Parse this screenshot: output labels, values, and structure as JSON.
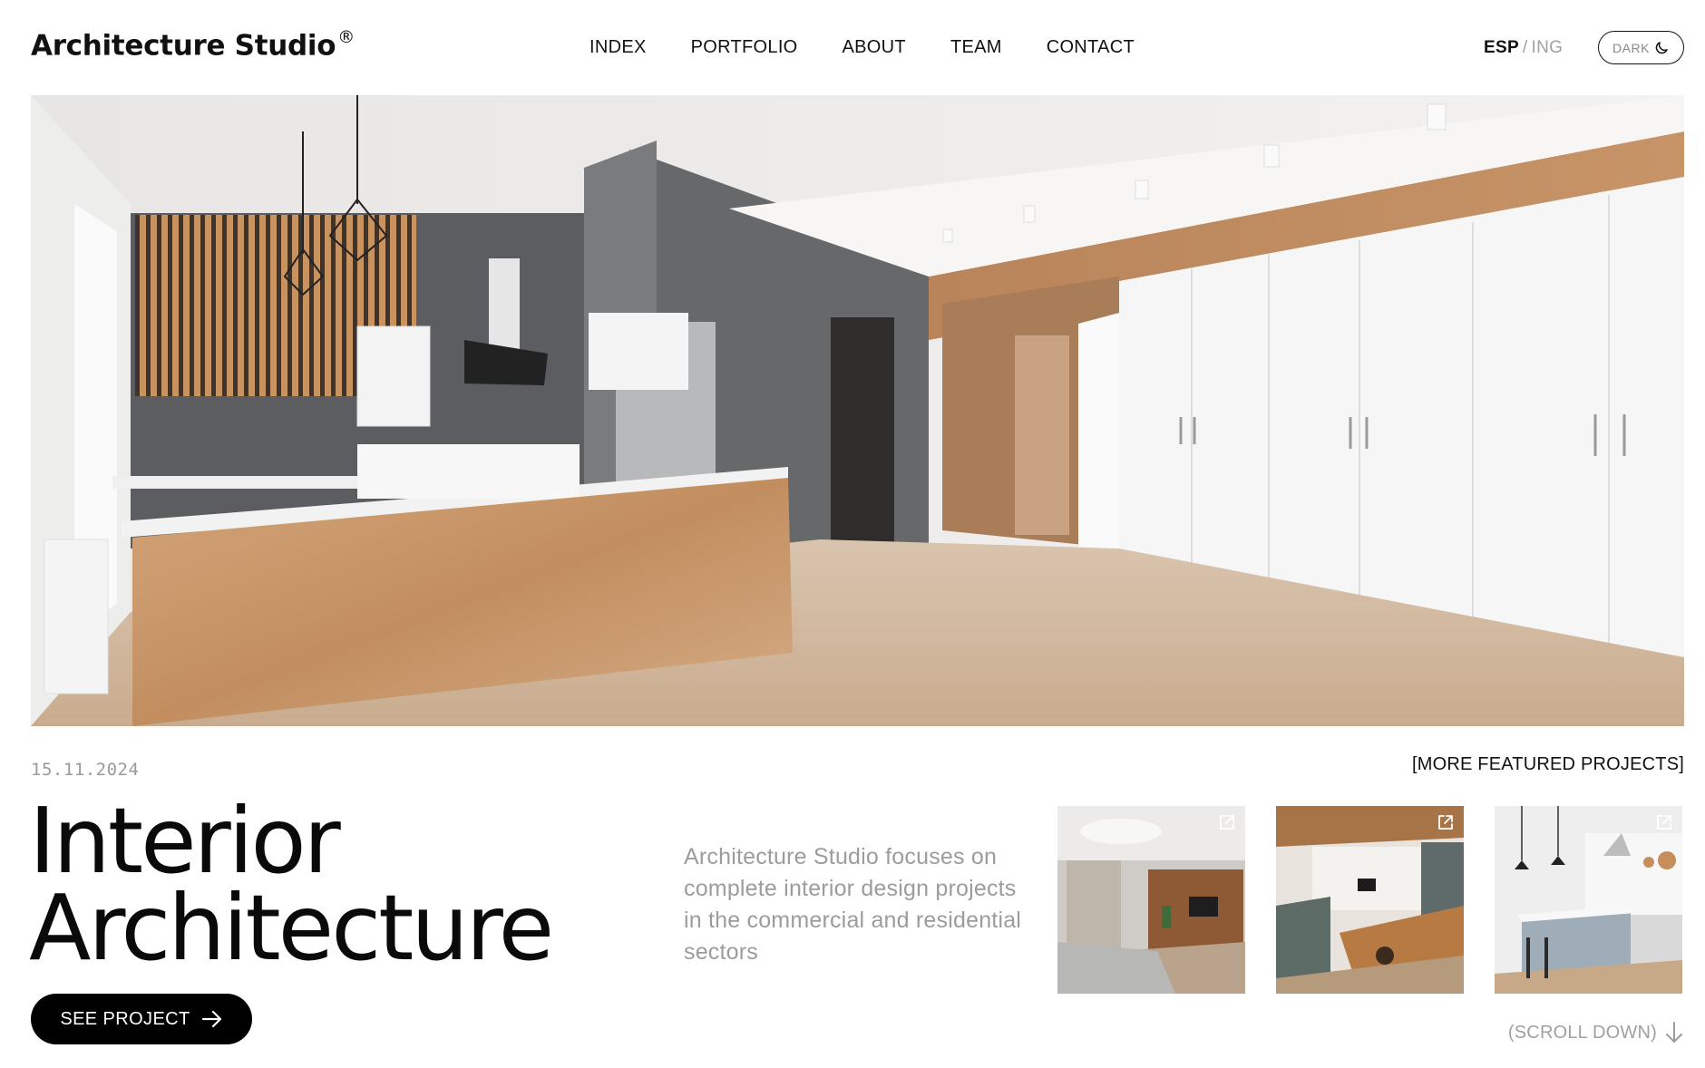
{
  "header": {
    "brand": "Architecture Studio",
    "brand_mark": "®",
    "nav": [
      "INDEX",
      "PORTFOLIO",
      "ABOUT",
      "TEAM",
      "CONTACT"
    ],
    "lang_active": "ESP",
    "lang_separator": "/",
    "lang_inactive": "ING",
    "theme_toggle_label": "DARK",
    "theme_toggle_icon": "moon-icon"
  },
  "hero": {
    "image": "interior-kitchen-living-photo"
  },
  "featured": {
    "date": "15.11.2024",
    "title_line1": "Interior",
    "title_line2": "Architecture",
    "cta_label": "SEE PROJECT",
    "cta_icon": "arrow-right-icon",
    "description": "Architecture Studio focuses on complete interior design projects in the commercial and residential sectors",
    "more_link": "[MORE FEATURED PROJECTS]",
    "thumbnails": [
      {
        "image": "living-room-photo",
        "icon": "external-link-icon"
      },
      {
        "image": "dining-kitchen-photo",
        "icon": "external-link-icon"
      },
      {
        "image": "kitchen-island-photo",
        "icon": "external-link-icon"
      }
    ],
    "scroll_hint": "(SCROLL DOWN)",
    "scroll_icon": "arrow-down-icon"
  },
  "colors": {
    "text": "#111111",
    "muted": "#9c9c9c",
    "button_bg": "#000000",
    "background": "#ffffff"
  }
}
